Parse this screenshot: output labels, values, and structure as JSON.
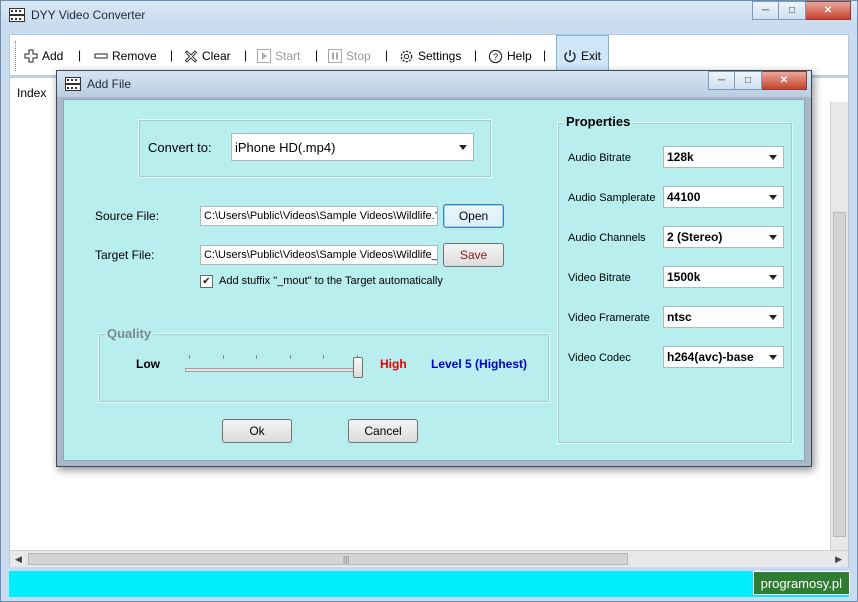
{
  "window": {
    "title": "DYY Video Converter",
    "minimize_glyph": "─",
    "maximize_glyph": "□",
    "close_glyph": "✕"
  },
  "toolbar": {
    "add": "Add",
    "remove": "Remove",
    "clear": "Clear",
    "start": "Start",
    "stop": "Stop",
    "settings": "Settings",
    "help": "Help",
    "exit": "Exit",
    "separator": "|"
  },
  "list": {
    "column_index": "Index"
  },
  "watermark": "programosy.pl",
  "dialog": {
    "title": "Add File",
    "convert_to_label": "Convert to:",
    "convert_to_value": "iPhone HD(.mp4)",
    "source_label": "Source File:",
    "source_value": "C:\\Users\\Public\\Videos\\Sample Videos\\Wildlife.’",
    "open_button": "Open",
    "target_label": "Target File:",
    "target_value": "C:\\Users\\Public\\Videos\\Sample Videos\\Wildlife_",
    "save_button": "Save",
    "suffix_checkbox_label": "Add stuffix \"_mout\" to the Target automatically",
    "suffix_checked": true,
    "quality": {
      "group_label": "Quality",
      "low_label": "Low",
      "high_label": "High",
      "level_label": "Level 5 (Highest)",
      "level": 5,
      "max_level": 5
    },
    "ok_button": "Ok",
    "cancel_button": "Cancel",
    "properties": {
      "group_label": "Properties",
      "audio_bitrate_label": "Audio Bitrate",
      "audio_bitrate_value": "128k",
      "audio_samplerate_label": "Audio Samplerate",
      "audio_samplerate_value": "44100",
      "audio_channels_label": "Audio Channels",
      "audio_channels_value": "2 (Stereo)",
      "video_bitrate_label": "Video Bitrate",
      "video_bitrate_value": "1500k",
      "video_framerate_label": "Video Framerate",
      "video_framerate_value": "ntsc",
      "video_codec_label": "Video Codec",
      "video_codec_value": "h264(avc)-base"
    }
  },
  "colors": {
    "dialog_bg": "#b9eeee",
    "status_bar": "#00eeff",
    "high_label": "#e00000",
    "level_label": "#0000cc",
    "watermark_bg": "#2e7d32"
  },
  "icons": [
    "app-icon",
    "plus-icon",
    "minus-icon",
    "clear-icon",
    "play-icon",
    "pause-icon",
    "gear-icon",
    "help-icon",
    "power-icon"
  ]
}
